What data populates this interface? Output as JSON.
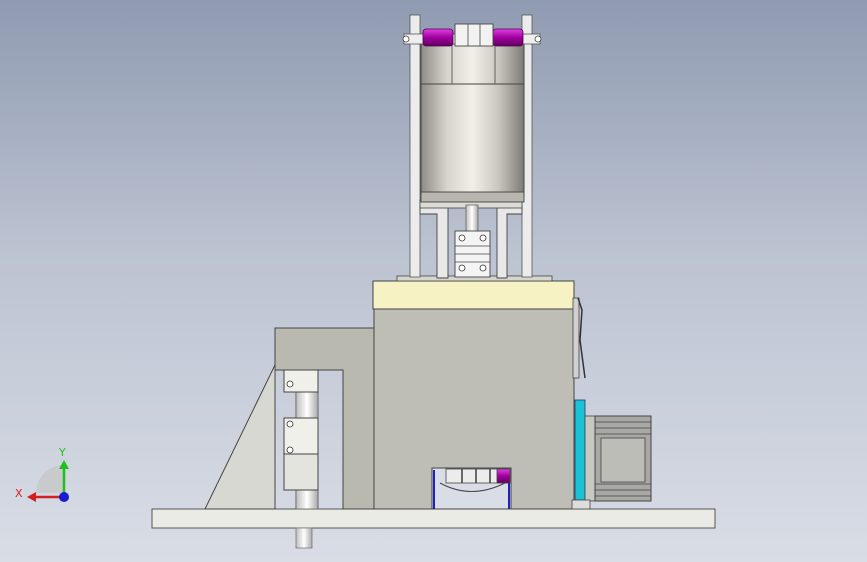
{
  "viewport": {
    "background_top": "#8f9bb1",
    "background_bottom": "#d9dde6"
  },
  "triad": {
    "x_label": "X",
    "y_label": "Y",
    "x_color": "#d22020",
    "y_color": "#1fbf1f",
    "z_color": "#1a1ad0"
  },
  "colors": {
    "base_plate": "#ebebe6",
    "housing": "#bebeb6",
    "top_cap": "#f7f2c4",
    "motor_body": "#c8c6be",
    "magenta_ring": "#c000c0",
    "cyan_plate": "#19c3d6",
    "gearbox": "#a8a8a4",
    "frame_rod": "#dcdcdc"
  },
  "icons": {
    "triad": "coordinate-triad-icon"
  }
}
